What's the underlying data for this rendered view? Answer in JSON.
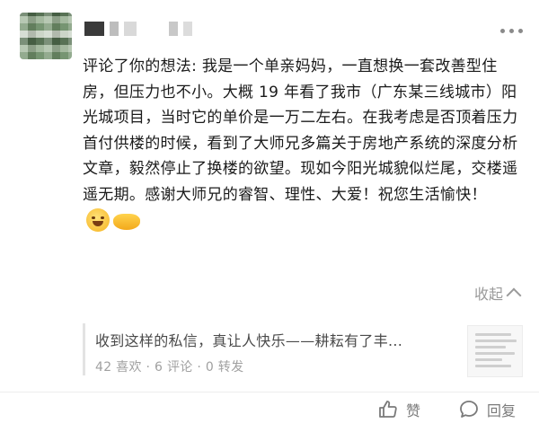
{
  "comment": {
    "text": "评论了你的想法: 我是一个单亲妈妈，一直想换一套改善型住房，但压力也不小。大概 19 年看了我市（广东某三线城市）阳光城项目，当时它的单价是一万二左右。在我考虑是否顶着压力首付供楼的时候，看到了大师兄多篇关于房地产系统的深度分析文章，毅然停止了换楼的欲望。现如今阳光城貌似烂尾，交楼遥遥无期。感谢大师兄的睿智、理性、大爱！祝您生活愉快！",
    "emojis": [
      "smile-emoji",
      "hands-emoji"
    ]
  },
  "collapse": {
    "label": "收起"
  },
  "quoted_post": {
    "title": "收到这样的私信，真让人快乐——耕耘有了丰...",
    "meta": "42 喜欢 · 6 评论 · 0 转发"
  },
  "actions": {
    "like_label": "赞",
    "reply_label": "回复"
  },
  "colors": {
    "text": "#1a1a1a",
    "muted": "#9a9a9a",
    "quote_bar": "#e3e3e3"
  }
}
